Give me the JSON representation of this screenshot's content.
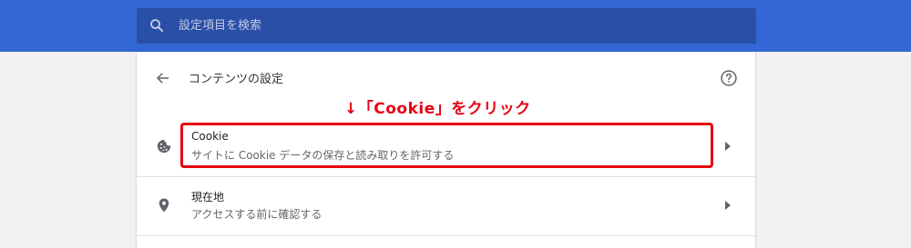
{
  "search": {
    "placeholder": "設定項目を検索",
    "icon": "search-icon"
  },
  "header": {
    "title": "コンテンツの設定",
    "back_icon": "back-arrow-icon",
    "help_icon": "help-icon"
  },
  "annotation": {
    "text": "↓「Cookie」をクリック",
    "color": "#e60012"
  },
  "rows": [
    {
      "icon": "cookie-icon",
      "title": "Cookie",
      "subtitle": "サイトに Cookie データの保存と読み取りを許可する"
    },
    {
      "icon": "location-pin-icon",
      "title": "現在地",
      "subtitle": "アクセスする前に確認する"
    }
  ],
  "colors": {
    "topbar": "#3367d6",
    "search_box": "#2a4fa6",
    "highlight": "#e60012"
  }
}
